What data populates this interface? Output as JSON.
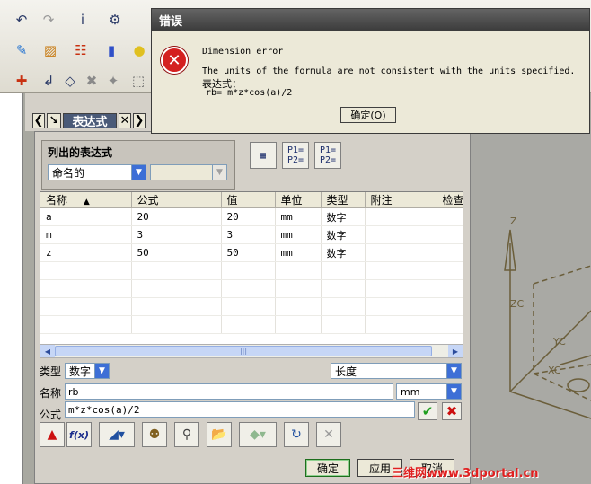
{
  "dialog": {
    "title": "错误",
    "line1": "Dimension error",
    "line2": "The units of the formula are not consistent with the units specified.",
    "line3": "表达式：",
    "line4": "rb= m*z*cos(a)/2",
    "ok_label": "确定(O)"
  },
  "tab": {
    "title": "表达式"
  },
  "listed": {
    "group_label": "列出的表达式",
    "filter_value": "命名的",
    "second_value": ""
  },
  "table": {
    "columns": [
      "名称",
      "公式",
      "值",
      "单位",
      "类型",
      "附注",
      "检查"
    ],
    "rows": [
      {
        "name": "a",
        "formula": "20",
        "value": "20",
        "unit": "mm",
        "type": "数字",
        "note": "",
        "check": ""
      },
      {
        "name": "m",
        "formula": "3",
        "value": "3",
        "unit": "mm",
        "type": "数字",
        "note": "",
        "check": ""
      },
      {
        "name": "z",
        "formula": "50",
        "value": "50",
        "unit": "mm",
        "type": "数字",
        "note": "",
        "check": ""
      }
    ],
    "scroll_grip": "|||"
  },
  "form": {
    "type_label": "类型",
    "type_value": "数字",
    "dimension_value": "长度",
    "name_label": "名称",
    "name_value": "rb",
    "unit_value": "mm",
    "formula_label": "公式",
    "formula_value": "m*z*cos(a)/2",
    "fx_label": "f(x)"
  },
  "buttons": {
    "ok": "确定",
    "apply": "应用",
    "cancel": "取消"
  },
  "viewport": {
    "axis_z": "Z",
    "axis_zc": "ZC",
    "axis_yc": "YC",
    "axis_xc": "XC"
  },
  "watermark": "三维网www.3dportal.cn",
  "colors": {
    "error_icon": "#d42020",
    "accept_check": "#1e9e1e",
    "reject_x": "#cc1010",
    "axis_lines": "#6b5e3a"
  }
}
